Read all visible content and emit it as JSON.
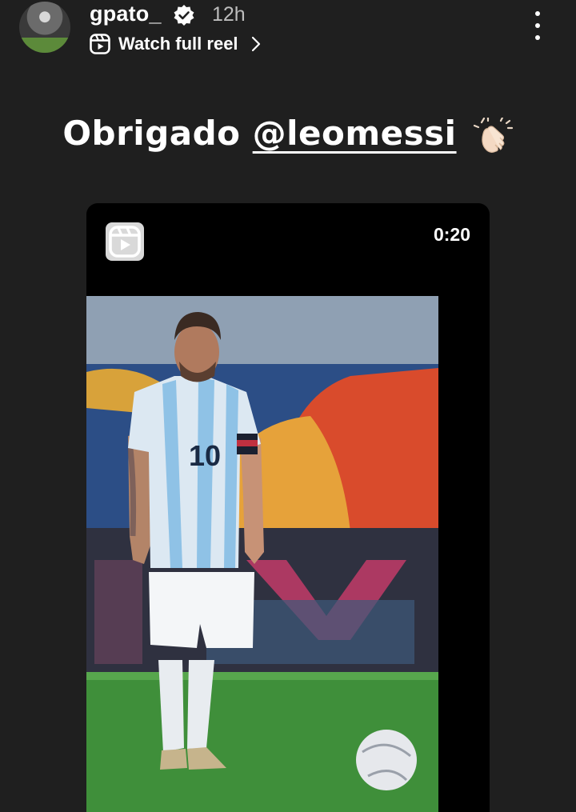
{
  "header": {
    "username": "gpato_",
    "time": "12h",
    "reel_link_label": "Watch full reel",
    "icons": {
      "verified": "verified-badge-icon",
      "reel": "reels-icon",
      "chevron": "chevron-right-icon",
      "menu": "more-vertical-icon"
    }
  },
  "caption": {
    "text": "Obrigado ",
    "mention": "@leomessi",
    "emoji": "clapping-hands"
  },
  "reel_card": {
    "duration": "0:20",
    "badge_icon": "reels-icon",
    "photo": {
      "jersey_number": "10",
      "description_icon": "soccer-player-photo"
    }
  },
  "colors": {
    "background": "#1f1f1f",
    "card": "#000000",
    "text": "#ffffff",
    "muted": "#bdbdbd"
  }
}
